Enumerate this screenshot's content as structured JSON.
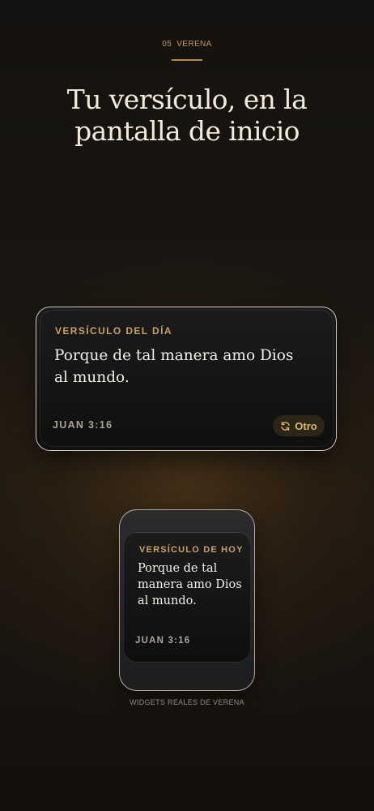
{
  "header": {
    "section_number": "05",
    "section_name": "VERENA",
    "title_line1": "Tu versículo, en la",
    "title_line2": "pantalla de inicio"
  },
  "wide_widget": {
    "label": "VERSÍCULO DEL DÍA",
    "verse_line1": "Porque de tal manera amo Dios",
    "verse_line2": "al mundo.",
    "reference": "JUAN 3:16",
    "button_label": "Otro",
    "button_icon": "refresh-icon"
  },
  "small_widget": {
    "label": "VERSÍCULO DE HOY",
    "verse_line1": "Porque de tal",
    "verse_line2": "manera amo Dios",
    "verse_line3": "al mundo.",
    "reference": "JUAN 3:16"
  },
  "caption": "WIDGETS REALES DE VERENA",
  "colors": {
    "accent_gold": "#c9a063",
    "title_cream": "#f3ead9",
    "widget_background": "#111112"
  }
}
